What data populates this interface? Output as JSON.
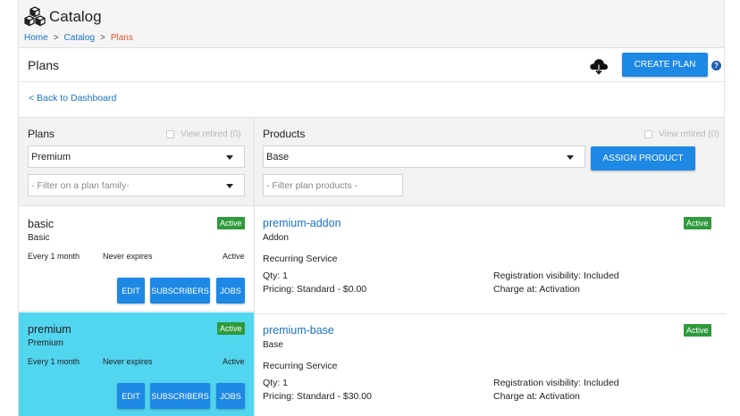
{
  "app": {
    "title": "Catalog",
    "logo_icon": "cubes-icon"
  },
  "breadcrumb": {
    "home": "Home",
    "sep1": ">",
    "catalog": "Catalog",
    "sep2": ">",
    "current": "Plans"
  },
  "header": {
    "title": "Plans",
    "download_icon": "cloud-download-icon",
    "create_label": "CREATE PLAN",
    "help": "?"
  },
  "back_link": "< Back to Dashboard",
  "plans_panel": {
    "title": "Plans",
    "view_retired": "View retired (0)",
    "selected_plan": "Premium",
    "family_filter_placeholder": "- Filter on a plan family-"
  },
  "products_panel": {
    "title": "Products",
    "view_retired": "View retired (0)",
    "selected_product": "Base",
    "filter_placeholder": "- Filter plan products -",
    "assign_label": "ASSIGN PRODUCT"
  },
  "plans": [
    {
      "name": "basic",
      "subtitle": "Basic",
      "badge": "Active",
      "billing": "Every 1 month",
      "expiry": "Never expires",
      "status": "Active",
      "edit": "EDIT",
      "subscribers": "SUBSCRIBERS",
      "jobs": "JOBS",
      "selected": false
    },
    {
      "name": "premium",
      "subtitle": "Premium",
      "badge": "Active",
      "billing": "Every 1 month",
      "expiry": "Never expires",
      "status": "Active",
      "edit": "EDIT",
      "subscribers": "SUBSCRIBERS",
      "jobs": "JOBS",
      "selected": true
    }
  ],
  "products": [
    {
      "name": "premium-addon",
      "subtitle": "Addon",
      "badge": "Active",
      "type": "Recurring Service",
      "qty": "Qty: 1",
      "pricing": "Pricing: Standard - $0.00",
      "visibility": "Registration visibility: Included",
      "charge": "Charge at:  Activation"
    },
    {
      "name": "premium-base",
      "subtitle": "Base",
      "badge": "Active",
      "type": "Recurring Service",
      "qty": "Qty: 1",
      "pricing": "Pricing: Standard - $30.00",
      "visibility": "Registration visibility: Included",
      "charge": "Charge at:  Activation"
    }
  ],
  "colors": {
    "accent": "#1e88e5",
    "selected_bg": "#52d5ef",
    "badge_green": "#2e9a3c",
    "link": "#1a73c5",
    "breadcrumb_current": "#e0562a"
  }
}
